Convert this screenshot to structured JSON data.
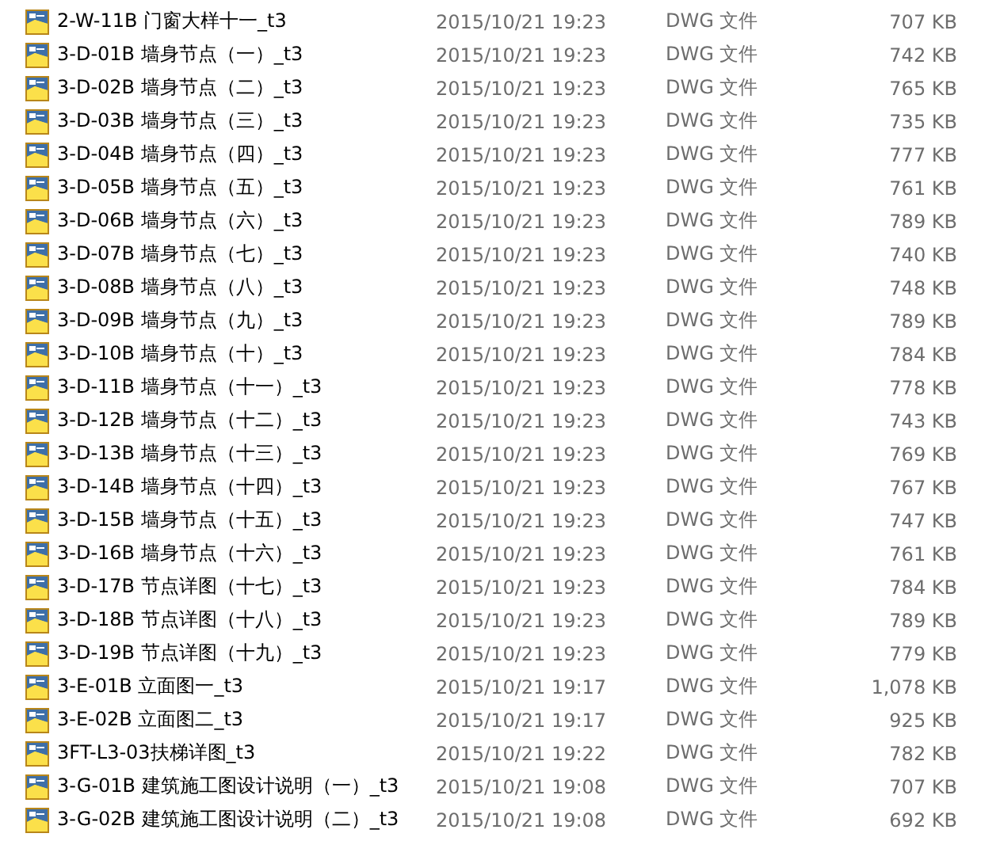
{
  "files": [
    {
      "name": "2-W-11B 门窗大样十一_t3",
      "modified": "2015/10/21 19:23",
      "type": "DWG 文件",
      "size": "707 KB"
    },
    {
      "name": "3-D-01B 墙身节点（一）_t3",
      "modified": "2015/10/21 19:23",
      "type": "DWG 文件",
      "size": "742 KB"
    },
    {
      "name": "3-D-02B 墙身节点（二）_t3",
      "modified": "2015/10/21 19:23",
      "type": "DWG 文件",
      "size": "765 KB"
    },
    {
      "name": "3-D-03B 墙身节点（三）_t3",
      "modified": "2015/10/21 19:23",
      "type": "DWG 文件",
      "size": "735 KB"
    },
    {
      "name": "3-D-04B 墙身节点（四）_t3",
      "modified": "2015/10/21 19:23",
      "type": "DWG 文件",
      "size": "777 KB"
    },
    {
      "name": "3-D-05B 墙身节点（五）_t3",
      "modified": "2015/10/21 19:23",
      "type": "DWG 文件",
      "size": "761 KB"
    },
    {
      "name": "3-D-06B 墙身节点（六）_t3",
      "modified": "2015/10/21 19:23",
      "type": "DWG 文件",
      "size": "789 KB"
    },
    {
      "name": "3-D-07B 墙身节点（七）_t3",
      "modified": "2015/10/21 19:23",
      "type": "DWG 文件",
      "size": "740 KB"
    },
    {
      "name": "3-D-08B 墙身节点（八）_t3",
      "modified": "2015/10/21 19:23",
      "type": "DWG 文件",
      "size": "748 KB"
    },
    {
      "name": "3-D-09B 墙身节点（九）_t3",
      "modified": "2015/10/21 19:23",
      "type": "DWG 文件",
      "size": "789 KB"
    },
    {
      "name": "3-D-10B 墙身节点（十）_t3",
      "modified": "2015/10/21 19:23",
      "type": "DWG 文件",
      "size": "784 KB"
    },
    {
      "name": "3-D-11B 墙身节点（十一）_t3",
      "modified": "2015/10/21 19:23",
      "type": "DWG 文件",
      "size": "778 KB"
    },
    {
      "name": "3-D-12B 墙身节点（十二）_t3",
      "modified": "2015/10/21 19:23",
      "type": "DWG 文件",
      "size": "743 KB"
    },
    {
      "name": "3-D-13B 墙身节点（十三）_t3",
      "modified": "2015/10/21 19:23",
      "type": "DWG 文件",
      "size": "769 KB"
    },
    {
      "name": "3-D-14B 墙身节点（十四）_t3",
      "modified": "2015/10/21 19:23",
      "type": "DWG 文件",
      "size": "767 KB"
    },
    {
      "name": "3-D-15B 墙身节点（十五）_t3",
      "modified": "2015/10/21 19:23",
      "type": "DWG 文件",
      "size": "747 KB"
    },
    {
      "name": "3-D-16B 墙身节点（十六）_t3",
      "modified": "2015/10/21 19:23",
      "type": "DWG 文件",
      "size": "761 KB"
    },
    {
      "name": "3-D-17B 节点详图（十七）_t3",
      "modified": "2015/10/21 19:23",
      "type": "DWG 文件",
      "size": "784 KB"
    },
    {
      "name": "3-D-18B 节点详图（十八）_t3",
      "modified": "2015/10/21 19:23",
      "type": "DWG 文件",
      "size": "789 KB"
    },
    {
      "name": "3-D-19B 节点详图（十九）_t3",
      "modified": "2015/10/21 19:23",
      "type": "DWG 文件",
      "size": "779 KB"
    },
    {
      "name": "3-E-01B 立面图一_t3",
      "modified": "2015/10/21 19:17",
      "type": "DWG 文件",
      "size": "1,078 KB"
    },
    {
      "name": "3-E-02B 立面图二_t3",
      "modified": "2015/10/21 19:17",
      "type": "DWG 文件",
      "size": "925 KB"
    },
    {
      "name": "3FT-L3-03扶梯详图_t3",
      "modified": "2015/10/21 19:22",
      "type": "DWG 文件",
      "size": "782 KB"
    },
    {
      "name": "3-G-01B 建筑施工图设计说明（一）_t3",
      "modified": "2015/10/21 19:08",
      "type": "DWG 文件",
      "size": "707 KB"
    },
    {
      "name": "3-G-02B 建筑施工图设计说明（二）_t3",
      "modified": "2015/10/21 19:08",
      "type": "DWG 文件",
      "size": "692 KB"
    }
  ]
}
